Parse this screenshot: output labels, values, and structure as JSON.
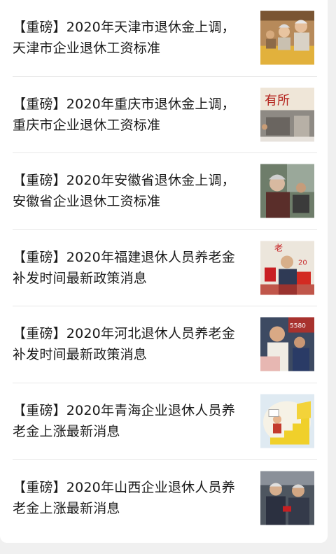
{
  "articles": [
    {
      "title": "【重磅】2020年天津市退休金上调，天津市企业退休工资标准",
      "image": "elderly-couple-photo"
    },
    {
      "title": "【重磅】2020年重庆市退休金上调，重庆市企业退休工资标准",
      "image": "storefront-sign-photo"
    },
    {
      "title": "【重磅】2020年安徽省退休金上调，安徽省企业退休工资标准",
      "image": "elderly-woman-photo"
    },
    {
      "title": "【重磅】2020年福建退休人员养老金补发时间最新政策消息",
      "image": "red-booklet-photo"
    },
    {
      "title": "【重磅】2020年河北退休人员养老金补发时间最新政策消息",
      "image": "elderly-man-photo"
    },
    {
      "title": "【重磅】2020年青海企业退休人员养老金上涨最新消息",
      "image": "cartoon-stairs-illustration"
    },
    {
      "title": "【重磅】2020年山西企业退休人员养老金上涨最新消息",
      "image": "elderly-group-photo"
    }
  ]
}
